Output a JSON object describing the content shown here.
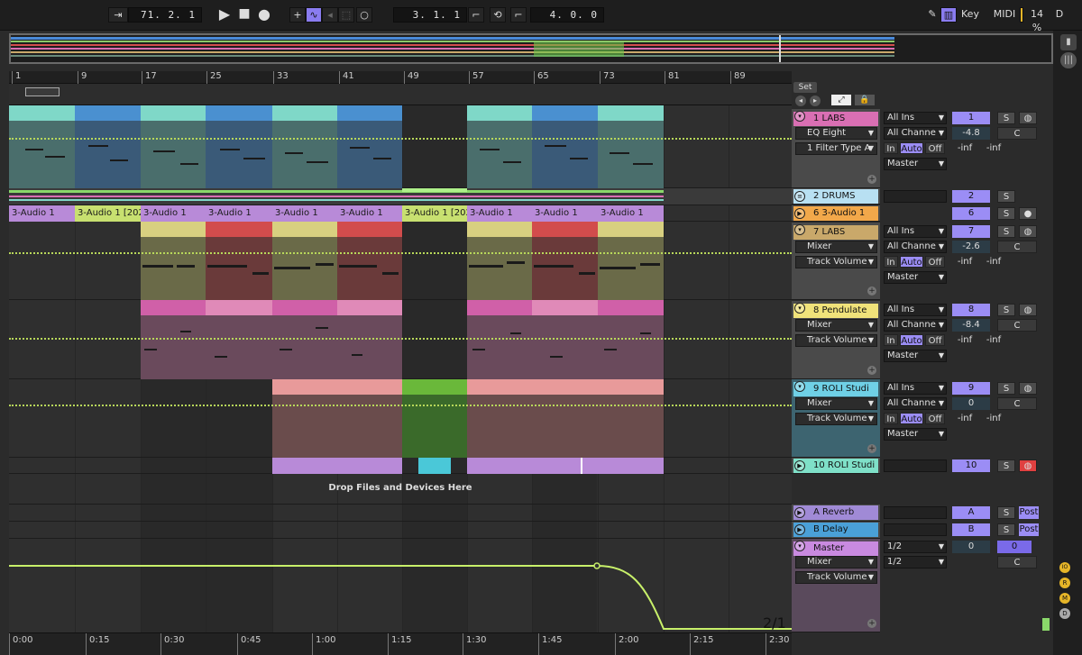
{
  "transport": {
    "tempo_follow_icon": "follow-icon",
    "position": "71.  2.  1",
    "loop_start": "3.  1.  1",
    "loop_length": "4.  0.  0",
    "key_label": "Key",
    "midi_label": "MIDI",
    "cpu": "14 %",
    "d_label": "D"
  },
  "ruler": {
    "bars": [
      "1",
      "9",
      "17",
      "25",
      "33",
      "41",
      "49",
      "57",
      "65",
      "73",
      "81",
      "89"
    ]
  },
  "time": {
    "labels": [
      "0:00",
      "0:15",
      "0:30",
      "0:45",
      "1:00",
      "1:15",
      "1:30",
      "1:45",
      "2:00",
      "2:15",
      "2:30"
    ]
  },
  "set_label": "Set",
  "drop_hint": "Drop Files and Devices Here",
  "page_counter": "2/1",
  "tracks": [
    {
      "name": "1 LABS",
      "color": "#d96fb3",
      "device": "EQ Eight",
      "param": "1 Filter Type A",
      "input": "All Ins",
      "channel": "All Channe",
      "output": "Master",
      "number": "1",
      "volume": "-4.8",
      "pan": "C",
      "in": "In",
      "auto": "Auto",
      "off": "Off",
      "sendA": "-inf",
      "sendB": "-inf",
      "solo": "S"
    },
    {
      "name": "2 DRUMS",
      "color": "#b8e0f2",
      "number": "2",
      "solo": "S"
    },
    {
      "name": "6 3-Audio 1",
      "color": "#f2a84a",
      "number": "6",
      "solo": "S"
    },
    {
      "name": "7 LABS",
      "color": "#c9a86a",
      "device": "Mixer",
      "param": "Track Volume",
      "input": "All Ins",
      "channel": "All Channe",
      "output": "Master",
      "number": "7",
      "volume": "-2.6",
      "pan": "C",
      "in": "In",
      "auto": "Auto",
      "off": "Off",
      "sendA": "-inf",
      "sendB": "-inf",
      "solo": "S"
    },
    {
      "name": "8 Pendulate",
      "color": "#f0e27a",
      "device": "Mixer",
      "param": "Track Volume",
      "input": "All Ins",
      "channel": "All Channe",
      "output": "Master",
      "number": "8",
      "volume": "-8.4",
      "pan": "C",
      "in": "In",
      "auto": "Auto",
      "off": "Off",
      "sendA": "-inf",
      "sendB": "-inf",
      "solo": "S"
    },
    {
      "name": "9 ROLI Studi",
      "color": "#6fd0e6",
      "device": "Mixer",
      "param": "Track Volume",
      "input": "All Ins",
      "channel": "All Channe",
      "output": "Master",
      "number": "9",
      "volume": "0",
      "pan": "C",
      "in": "In",
      "auto": "Auto",
      "off": "Off",
      "sendA": "-inf",
      "sendB": "-inf",
      "solo": "S"
    },
    {
      "name": "10 ROLI Studi",
      "color": "#7fe0c8",
      "number": "10",
      "solo": "S"
    }
  ],
  "returns": [
    {
      "name": "A Reverb",
      "color": "#a08ad6",
      "number": "A",
      "post": "Post",
      "solo": "S"
    },
    {
      "name": "B Delay",
      "color": "#4aa0d8",
      "number": "B",
      "post": "Post",
      "solo": "S"
    }
  ],
  "master": {
    "name": "Master",
    "color": "#c98ae0",
    "device": "Mixer",
    "param": "Track Volume",
    "out1": "1/2",
    "out2": "1/2",
    "volume": "0",
    "volume2": "0",
    "pan": "C"
  },
  "audio_clips": [
    "3-Audio 1",
    "3-Audio 1 [202",
    "3-Audio 1",
    "3-Audio 1",
    "3-Audio 1",
    "3-Audio 1",
    "3-Audio 1 [202",
    "3-Audio 1",
    "3-Audio 1",
    "3-Audio 1"
  ],
  "side_buttons": [
    "IO",
    "R",
    "M",
    "D"
  ]
}
